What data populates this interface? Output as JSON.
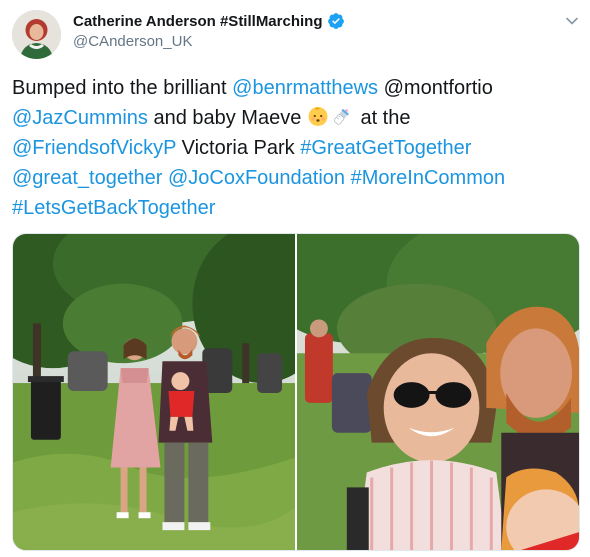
{
  "tweet": {
    "author_name": "Catherine Anderson #StillMarching",
    "author_handle": "@CAnderson_UK",
    "text_segments": [
      {
        "text": "Bumped into the brilliant ",
        "link": false
      },
      {
        "text": "@benrmatthews",
        "link": true
      },
      {
        "text": " @montfortio ",
        "link": false
      },
      {
        "text": "@JazCummins",
        "link": true
      },
      {
        "text": " and baby Maeve ",
        "link": false
      },
      {
        "text": " at the ",
        "link": false
      },
      {
        "text": "@FriendsofVickyP",
        "link": true
      },
      {
        "text": " Victoria Park ",
        "link": false
      },
      {
        "text": "#GreatGetTogether",
        "link": true
      },
      {
        "text": "@great_together",
        "link": true
      },
      {
        "text": " ",
        "link": false
      },
      {
        "text": "@JoCoxFoundation",
        "link": true
      },
      {
        "text": " ",
        "link": false
      },
      {
        "text": "#MoreInCommon",
        "link": true
      },
      {
        "text": "#LetsGetBackTogether",
        "link": true
      }
    ],
    "emojis": [
      "baby-face-icon",
      "baby-bottle-icon"
    ]
  },
  "media": {
    "count": 2,
    "photos": [
      "park-group-photo",
      "park-selfie-photo"
    ]
  },
  "colors": {
    "link": "#1b95e0",
    "text": "#14171a",
    "secondary": "#657786",
    "verified": "#1da1f2"
  }
}
